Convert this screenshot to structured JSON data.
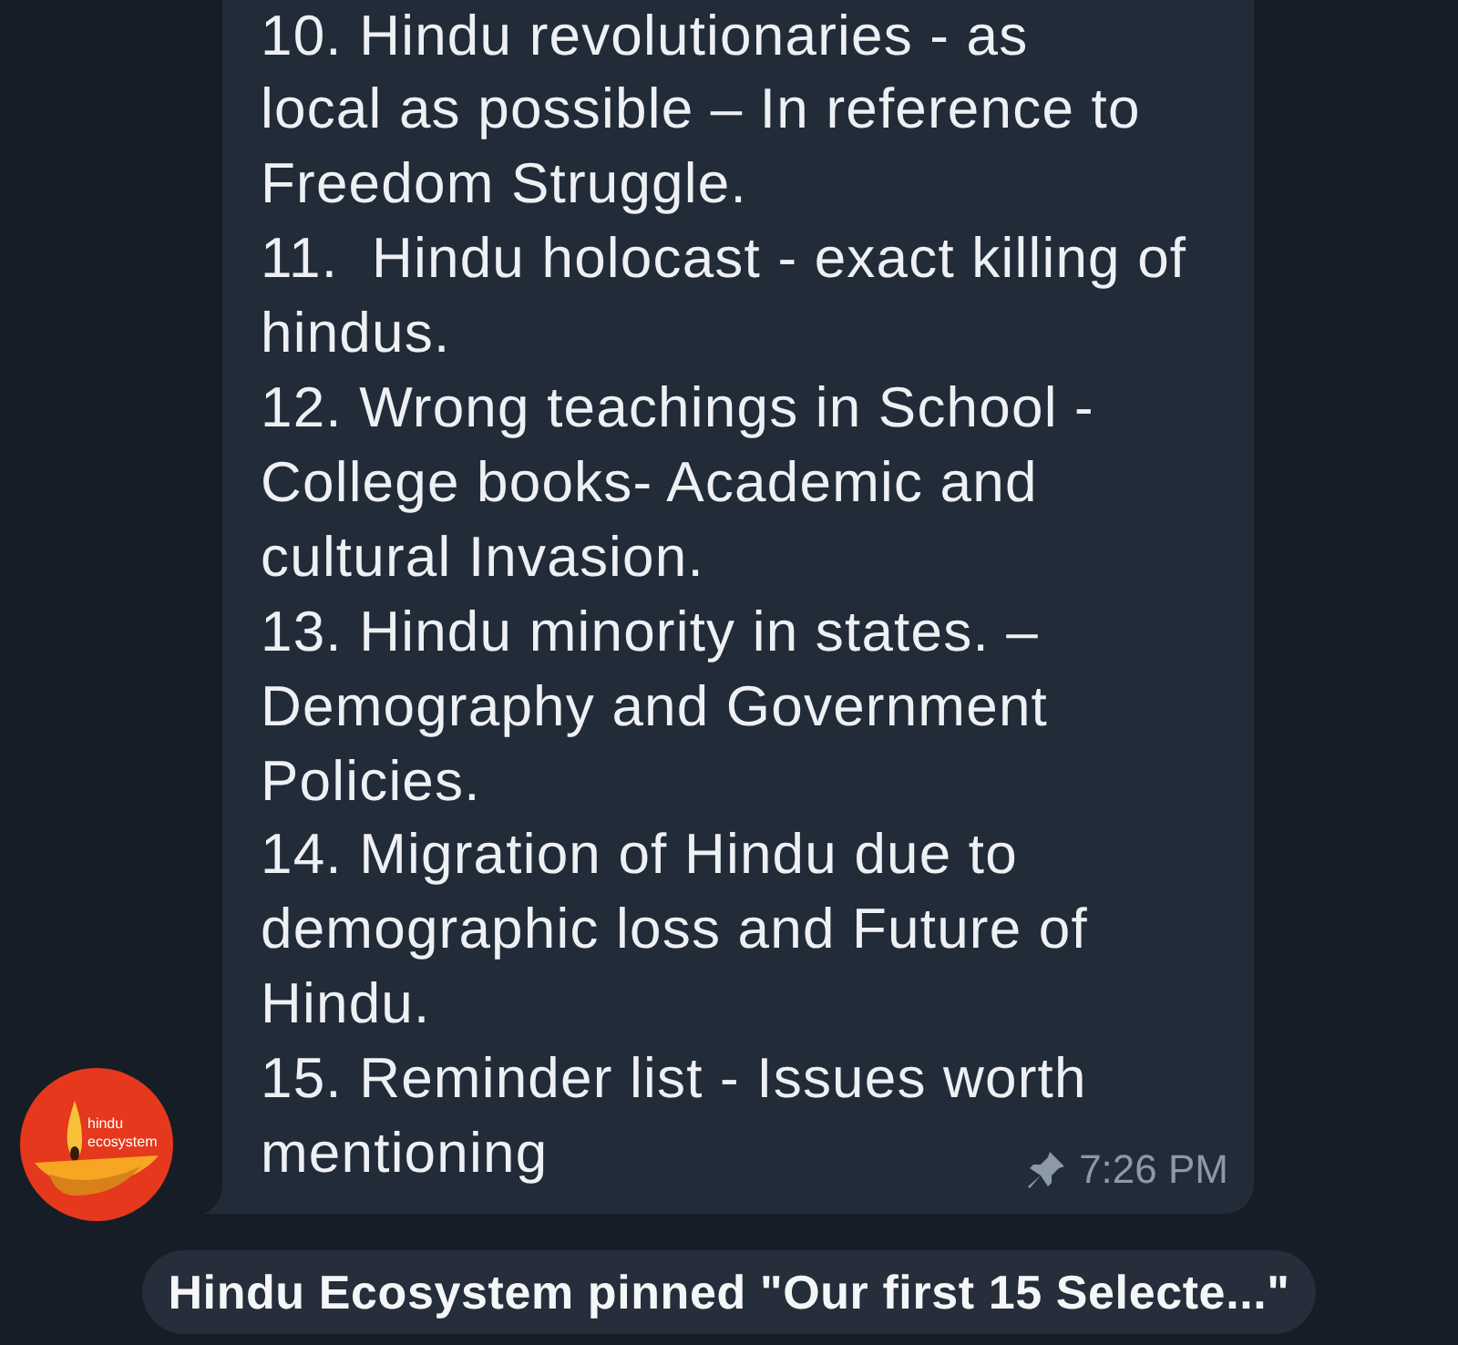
{
  "message": {
    "items": [
      {
        "lines": [
          "10. Hindu revolutionaries - as",
          "local as possible – In reference to",
          "Freedom Struggle."
        ]
      },
      {
        "lines": [
          "11.  Hindu holocast - exact killing of",
          "hindus."
        ]
      },
      {
        "lines": [
          "12. Wrong teachings in School -",
          "College books- Academic and",
          "cultural Invasion."
        ]
      },
      {
        "lines": [
          "13. Hindu minority in states. –",
          "Demography and Government",
          "Policies."
        ]
      },
      {
        "lines": [
          "14. Migration of Hindu due to",
          "demographic loss and Future of",
          "Hindu."
        ]
      },
      {
        "lines": [
          "15. Reminder list - Issues worth",
          "mentioning"
        ]
      }
    ],
    "pinned": true,
    "time": "7:26 PM"
  },
  "avatar": {
    "lines": [
      "hindu",
      "ecosystem"
    ]
  },
  "service_message": {
    "text": "Hindu Ecosystem pinned \"Our first 15 Selecte...\""
  }
}
